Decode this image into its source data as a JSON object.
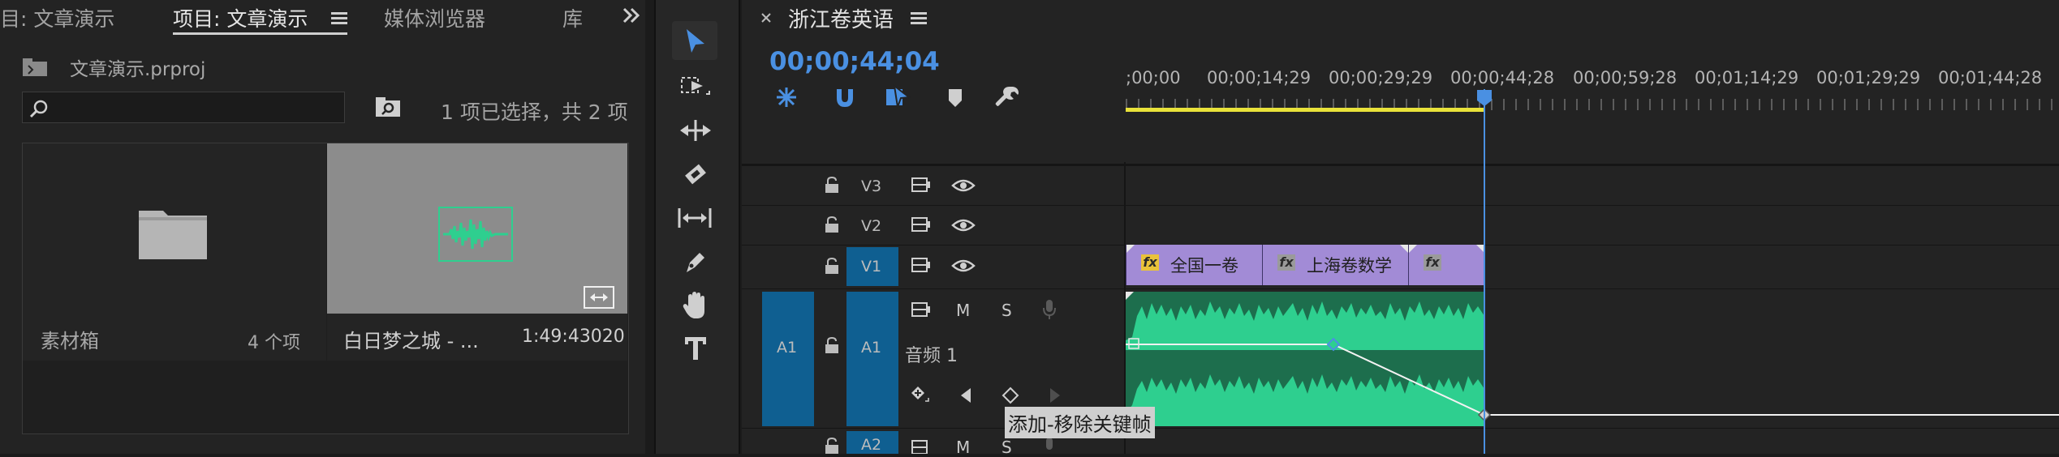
{
  "project_panel": {
    "tabs": [
      {
        "label": "目: 文章演示"
      },
      {
        "label": "项目: 文章演示"
      },
      {
        "label": "媒体浏览器"
      },
      {
        "label": "库"
      }
    ],
    "overflow_icon": "double-chevron-right-icon",
    "project_file": "文章演示.prproj",
    "search": {
      "value": "",
      "placeholder": ""
    },
    "selection_status": "1 项已选择，共 2 项",
    "items": [
      {
        "name": "素材箱",
        "meta": "4 个项",
        "icon": "folder-icon"
      },
      {
        "name": "白日梦之城 - ...",
        "meta": "1:49:43020",
        "icon": "audio-waveform-icon"
      }
    ]
  },
  "tools": [
    {
      "name": "selection-tool",
      "icon": "arrow-icon",
      "selected": true
    },
    {
      "name": "track-select-forward-tool",
      "icon": "track-select-icon"
    },
    {
      "name": "ripple-edit-tool",
      "icon": "ripple-edit-icon"
    },
    {
      "name": "razor-tool",
      "icon": "razor-icon"
    },
    {
      "name": "slip-tool",
      "icon": "slip-icon"
    },
    {
      "name": "pen-tool",
      "icon": "pen-icon"
    },
    {
      "name": "hand-tool",
      "icon": "hand-icon"
    },
    {
      "name": "type-tool",
      "icon": "type-icon"
    }
  ],
  "timeline": {
    "sequence_name": "浙江卷英语",
    "timecode": "00;00;44;04",
    "ruler_labels": [
      ";00;00",
      "00;00;14;29",
      "00;00;29;29",
      "00;00;44;28",
      "00;00;59;28",
      "00;01;14;29",
      "00;01;29;29",
      "00;01;44;28"
    ],
    "tracks": {
      "v3": "V3",
      "v2": "V2",
      "v1": "V1",
      "a1_source": "A1",
      "a1": "A1",
      "a1_name": "音频 1",
      "a2": "A2",
      "mute": "M",
      "solo": "S"
    },
    "video_clips": [
      {
        "name": "全国一卷"
      },
      {
        "name": "上海卷数学"
      },
      {
        "name": ""
      }
    ],
    "tooltip": "添加-移除关键帧",
    "colors": {
      "accent": "#4a90e2",
      "audio_clip": "#2ecf8f",
      "video_clip": "#a28bd6",
      "work_area": "#e9e23a"
    }
  }
}
